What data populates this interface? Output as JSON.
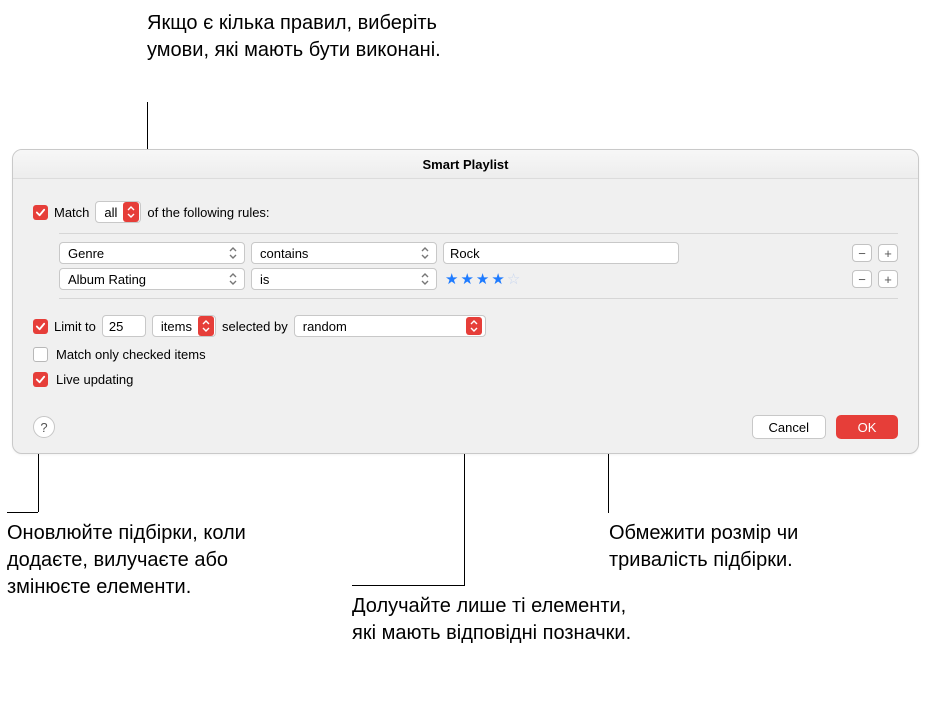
{
  "annotations": {
    "top": "Якщо є кілька правил, виберіть умови, які мають бути виконані.",
    "bottom_left": "Оновлюйте підбірки, коли додаєте, вилучаєте або змінюєте елементи.",
    "bottom_mid": "Долучайте лише ті елементи, які мають відповідні позначки.",
    "bottom_right": "Обмежити розмір чи тривалість підбірки."
  },
  "dialog": {
    "title": "Smart Playlist",
    "match_label_pre": "Match",
    "match_mode": "all",
    "match_label_post": "of the following rules:",
    "rules": [
      {
        "field": "Genre",
        "op": "contains",
        "value": "Rock",
        "value_type": "text"
      },
      {
        "field": "Album Rating",
        "op": "is",
        "value_type": "stars",
        "stars_filled": 4,
        "stars_total": 5
      }
    ],
    "limit": {
      "label": "Limit to",
      "count": "25",
      "unit": "items",
      "selected_by_label": "selected by",
      "method": "random"
    },
    "match_checked_label": "Match only checked items",
    "live_updating_label": "Live updating",
    "buttons": {
      "help": "?",
      "cancel": "Cancel",
      "ok": "OK"
    },
    "icons": {
      "minus": "−",
      "plus": "+"
    }
  }
}
